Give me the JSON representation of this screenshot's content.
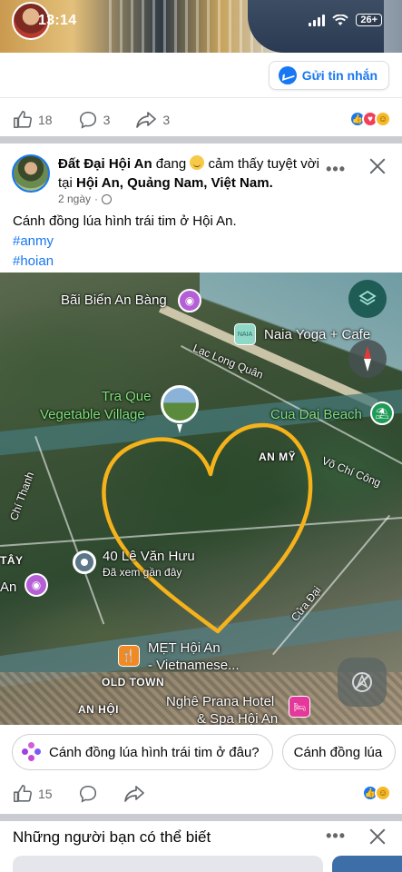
{
  "status_bar": {
    "time": "13:14",
    "battery": "26+"
  },
  "prev_post": {
    "message_button": "Gửi tin nhắn",
    "likes": "18",
    "comments": "3",
    "shares": "3"
  },
  "post": {
    "author": "Đất Đại Hội An",
    "action_pre": "đang",
    "feeling": "cảm thấy tuyệt vời",
    "location_pre": "tại",
    "location": "Hội An, Quảng Nam, Việt Nam",
    "time": "2 ngày",
    "text": "Cánh đồng lúa hình trái tim ở Hội An.",
    "tags": [
      "#anmy",
      "#hoian"
    ],
    "likes": "15"
  },
  "map": {
    "labels": {
      "an_bang": "Bãi Biển An Bàng",
      "naia": "Naia Yoga + Cafe",
      "lac_long_quan": "Lạc Long Quân",
      "tra_que_1": "Tra Que",
      "tra_que_2": "Vegetable Village",
      "cua_dai_beach": "Cua Dai Beach",
      "an_my": "AN MỸ",
      "vo_chi_cong": "Võ Chí Công",
      "chi_thanh": "Chí Thanh",
      "tay": "TÂY",
      "an": "An",
      "le_van_huu": "40 Lê Văn Hưu",
      "viewed": "Đã xem gần đây",
      "cua_dai": "Cửa Đại",
      "met_1": "MẸT Hội An",
      "met_2": "- Vietnamese...",
      "old_town": "OLD TOWN",
      "an_hoi": "AN HỘI",
      "prana_1": "Nghê Prana Hotel",
      "prana_2": "& Spa Hội An"
    },
    "naia_icon_text": "NAIA",
    "heart_color": "#f5b21b"
  },
  "chips": [
    "Cánh đồng lúa hình trái tim ở đâu?",
    "Cánh đồng lúa"
  ],
  "pymk": {
    "title": "Những người bạn có thể biết"
  },
  "colors": {
    "brand": "#1877f2",
    "text_secondary": "#65676b"
  }
}
